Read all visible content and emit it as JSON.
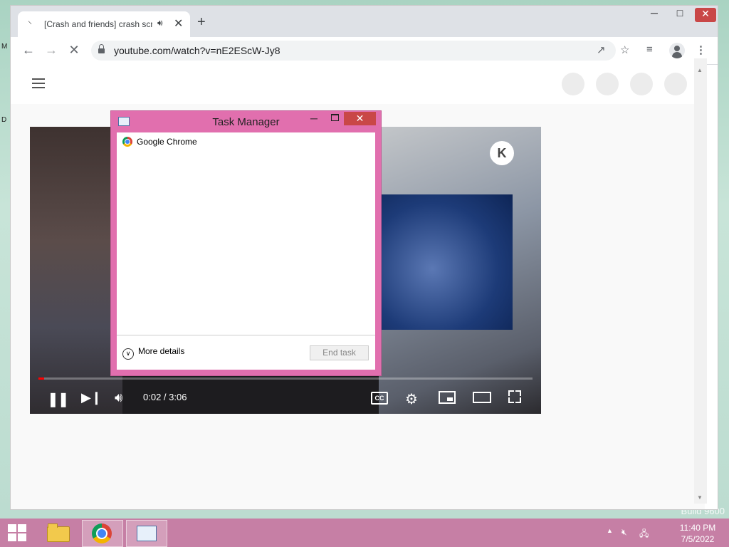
{
  "browser": {
    "tab_title": "[Crash and friends] crash scr",
    "url": "youtube.com/watch?v=nE2EScW-Jy8",
    "icons": [
      "throbber-icon",
      "audio-icon",
      "close-icon",
      "plus-icon",
      "back-icon",
      "forward-icon",
      "stop-icon",
      "lock-icon",
      "share-icon",
      "star-icon",
      "media-icon",
      "profile-icon",
      "menu-icon"
    ]
  },
  "video": {
    "time": "0:02 / 3:06",
    "progress": 0.011,
    "overlay_badge": "K",
    "cc_label": "CC"
  },
  "task_manager": {
    "title": "Task Manager",
    "process": "Google Chrome",
    "more_details": "More details",
    "end_task": "End task"
  },
  "taskbar": {
    "time": "11:40 PM",
    "date": "7/5/2022"
  },
  "desktop": {
    "watermark": "Build 9600",
    "edge_text_1": "M",
    "edge_text_2": "D"
  },
  "colors": {
    "accent": "#e16fae",
    "taskbar": "#c67fa5",
    "close": "#c94747",
    "progress": "#ff0000"
  }
}
